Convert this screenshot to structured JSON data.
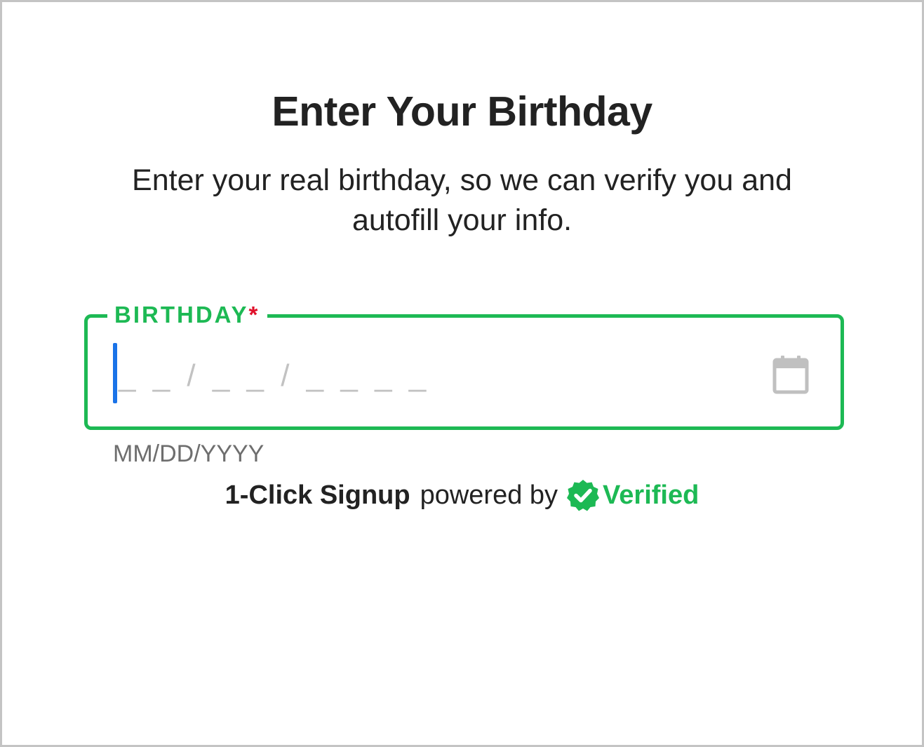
{
  "page": {
    "title": "Enter Your Birthday",
    "subtitle": "Enter your real birthday, so we can verify you and autofill your info."
  },
  "birthday_field": {
    "label": "BIRTHDAY",
    "required_marker": "*",
    "mask": "_ _ / _ _ / _ _ _ _",
    "value": "",
    "helper_text": "MM/DD/YYYY",
    "calendar_icon": "calendar-icon"
  },
  "footer": {
    "brand": "1-Click Signup",
    "powered_by": "powered by",
    "verified_icon": "verified-badge-icon",
    "provider": "Verified"
  },
  "colors": {
    "accent_green": "#1db954",
    "required_red": "#e0102a",
    "caret_blue": "#1a73e8",
    "text_dark": "#222222",
    "placeholder_gray": "#c2c2c2",
    "helper_gray": "#6e6e6e"
  }
}
